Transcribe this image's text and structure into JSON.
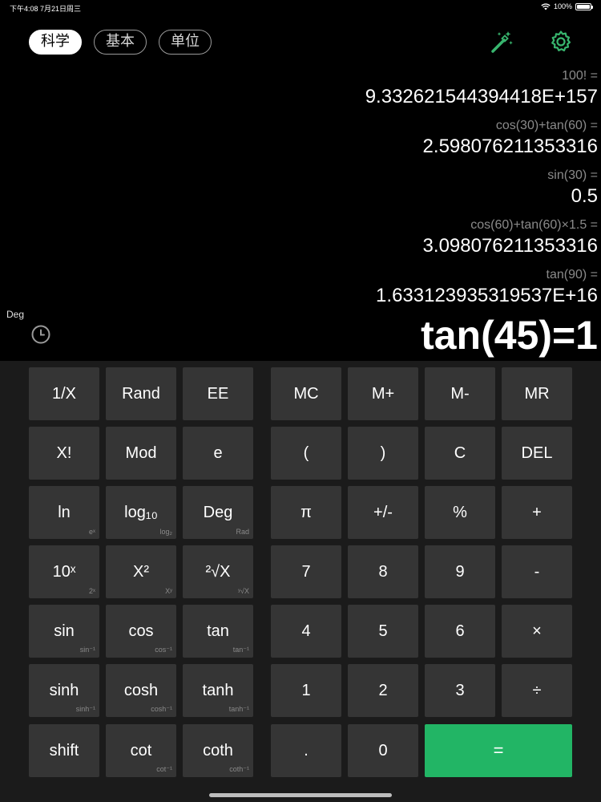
{
  "status_bar": {
    "time_date": "下午4:08   7月21日周三",
    "battery": "100%"
  },
  "mode_tabs": [
    "科学",
    "基本",
    "单位"
  ],
  "history": [
    {
      "expr": "100! =",
      "result": "9.332621544394418E+157"
    },
    {
      "expr": "cos(30)+tan(60) =",
      "result": "2.598076211353316"
    },
    {
      "expr": "sin(30) =",
      "result": "0.5"
    },
    {
      "expr": "cos(60)+tan(60)×1.5 =",
      "result": "3.098076211353316"
    },
    {
      "expr": "tan(90) =",
      "result": "1.633123935319537E+16"
    }
  ],
  "angle_mode": "Deg",
  "display": "tan(45)=1",
  "keys": {
    "k_1x": "1/X",
    "k_rand": "Rand",
    "k_ee": "EE",
    "k_mc": "MC",
    "k_mplus": "M+",
    "k_mminus": "M-",
    "k_mr": "MR",
    "k_fact": "X!",
    "k_mod": "Mod",
    "k_e": "e",
    "k_lparen": "(",
    "k_rparen": ")",
    "k_c": "C",
    "k_del": "DEL",
    "k_ln": "ln",
    "k_ln_sub": "eˣ",
    "k_log10": "log₁₀",
    "k_log10_sub": "log₂",
    "k_deg": "Deg",
    "k_deg_sub": "Rad",
    "k_pi": "π",
    "k_sign": "+/-",
    "k_pct": "%",
    "k_plus": "+",
    "k_10x": "10ˣ",
    "k_10x_sub": "2ˣ",
    "k_x2": "X²",
    "k_x2_sub": "Xʸ",
    "k_sqrt": "²√X",
    "k_sqrt_sub": "ʸ√X",
    "k_7": "7",
    "k_8": "8",
    "k_9": "9",
    "k_minus": "-",
    "k_sin": "sin",
    "k_sin_sub": "sin⁻¹",
    "k_cos": "cos",
    "k_cos_sub": "cos⁻¹",
    "k_tan": "tan",
    "k_tan_sub": "tan⁻¹",
    "k_4": "4",
    "k_5": "5",
    "k_6": "6",
    "k_mul": "×",
    "k_sinh": "sinh",
    "k_sinh_sub": "sinh⁻¹",
    "k_cosh": "cosh",
    "k_cosh_sub": "cosh⁻¹",
    "k_tanh": "tanh",
    "k_tanh_sub": "tanh⁻¹",
    "k_1": "1",
    "k_2": "2",
    "k_3": "3",
    "k_div": "÷",
    "k_shift": "shift",
    "k_cot": "cot",
    "k_cot_sub": "cot⁻¹",
    "k_coth": "coth",
    "k_coth_sub": "coth⁻¹",
    "k_dot": ".",
    "k_0": "0",
    "k_eq": "="
  },
  "colors": {
    "background": "#000000",
    "keypad_bg": "#1b1b1b",
    "key_bg": "#353535",
    "equals_bg": "#22b565",
    "icon_green": "#38b56e"
  },
  "icons": [
    "wifi-icon",
    "battery-icon",
    "magic-wand-icon",
    "gear-icon",
    "history-clock-icon"
  ]
}
